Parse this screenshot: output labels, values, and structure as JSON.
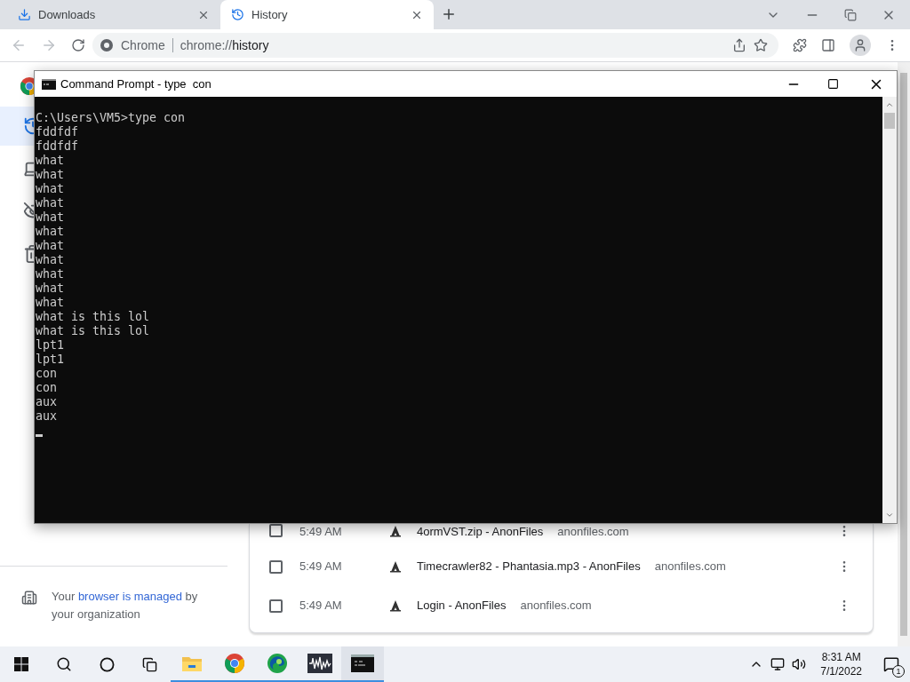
{
  "tabs": [
    {
      "label": "Downloads",
      "selected": false
    },
    {
      "label": "History",
      "selected": true
    }
  ],
  "address_bar": {
    "site": "Chrome",
    "url_scheme": "chrome://",
    "url_path": "history"
  },
  "sidebar": {
    "items": [
      {
        "selected": true
      },
      {
        "selected": false
      },
      {
        "selected": false
      },
      {
        "selected": false
      }
    ],
    "managed_note": "Your **browser is managed** by your organization"
  },
  "history_rows": [
    {
      "time": "5:49 AM",
      "title": "4ormVST.zip - AnonFiles",
      "domain": "anonfiles.com",
      "checked": false
    },
    {
      "time": "5:49 AM",
      "title": "Timecrawler82 - Phantasia.mp3 - AnonFiles",
      "domain": "anonfiles.com",
      "checked": false
    },
    {
      "time": "5:49 AM",
      "title": "Login - AnonFiles",
      "domain": "anonfiles.com",
      "checked": false
    }
  ],
  "console_window": {
    "title": "Command Prompt - type  con",
    "lines": [
      "C:\\Users\\VM5>type con",
      "fddfdf",
      "fddfdf",
      "what",
      "what",
      "what",
      "what",
      "what",
      "what",
      "what",
      "what",
      "what",
      "what",
      "what",
      "what is this lol",
      "what is this lol",
      "lpt1",
      "lpt1",
      "con",
      "con",
      "aux",
      "aux"
    ],
    "cursor": true
  },
  "taskbar": {
    "apps": [
      {
        "kind": "explorer",
        "active": false
      },
      {
        "kind": "chrome",
        "active": false
      },
      {
        "kind": "edge",
        "active": false
      },
      {
        "kind": "audio",
        "active": false
      },
      {
        "kind": "console",
        "active": true
      }
    ],
    "time": "8:31 AM",
    "date": "7/1/2022",
    "notifications": "1"
  }
}
